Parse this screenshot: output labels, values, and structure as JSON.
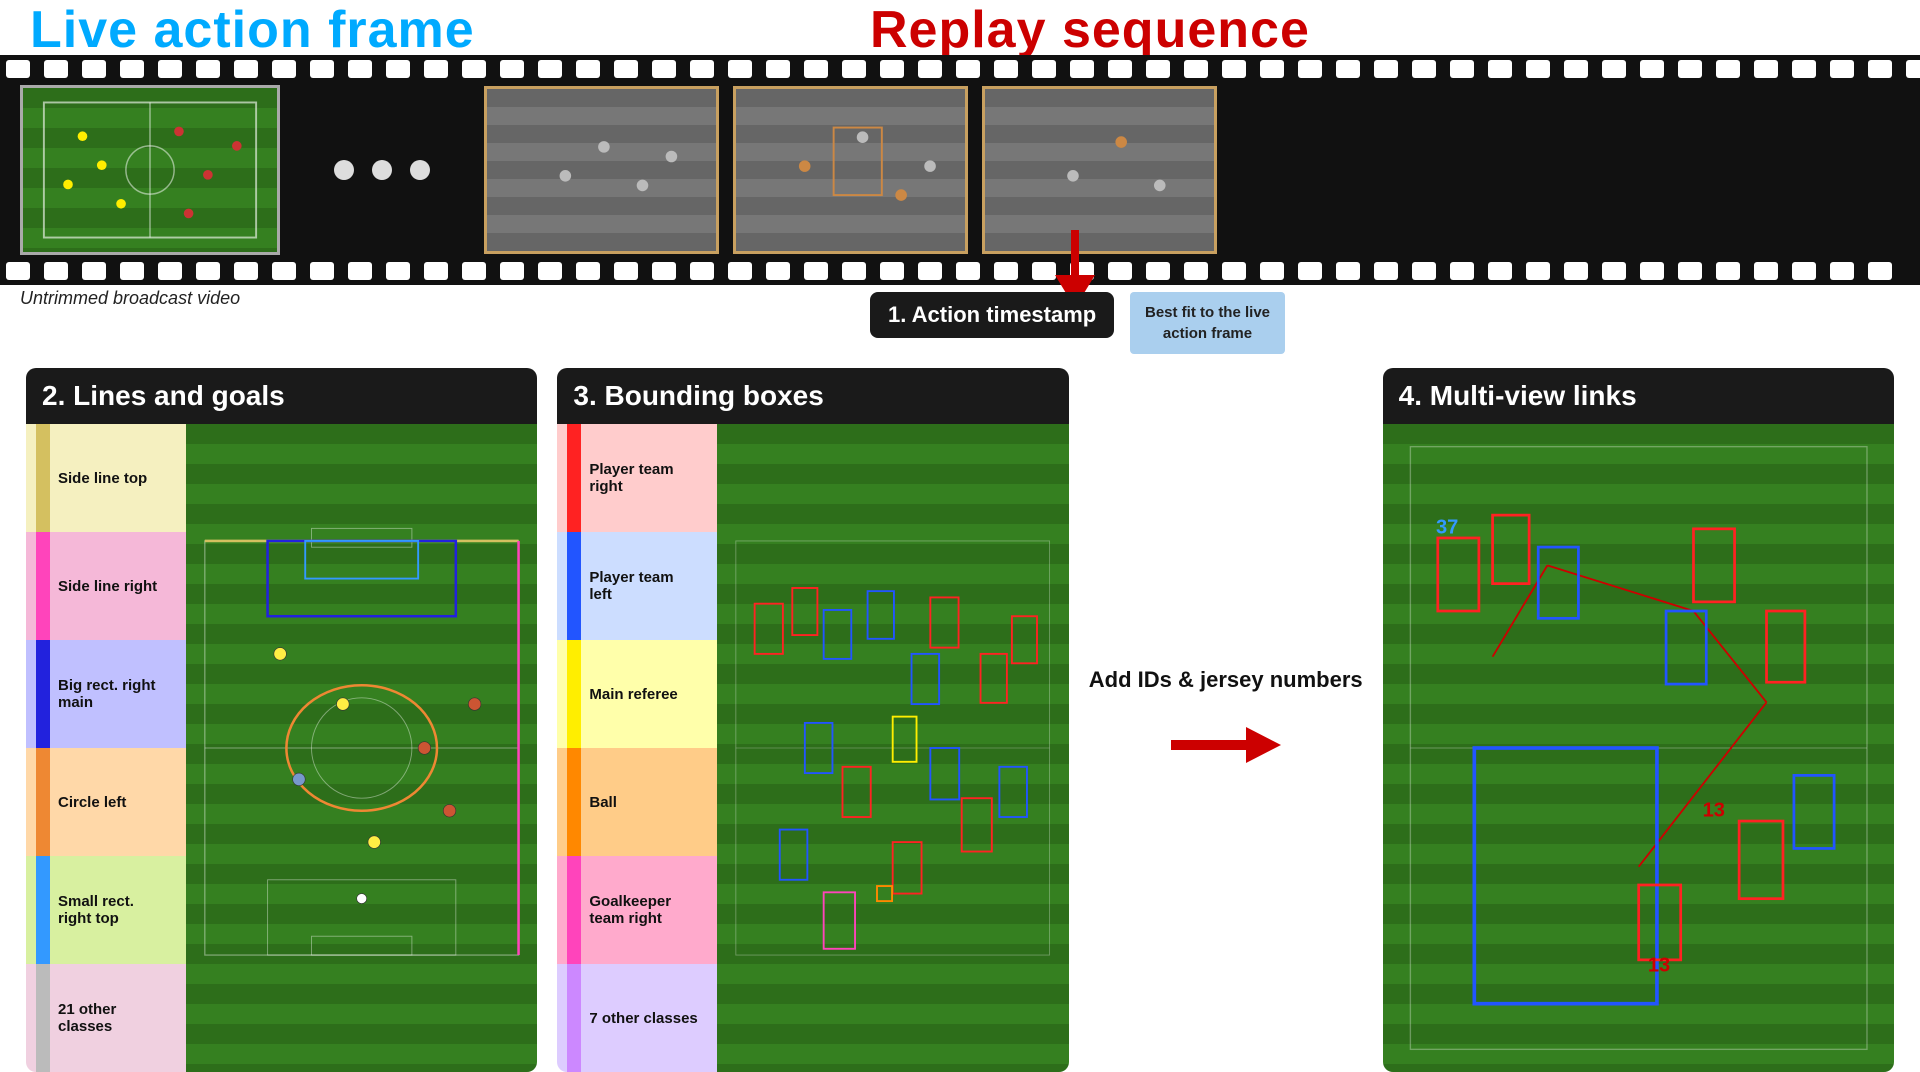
{
  "header": {
    "live_title": "Live action frame",
    "replay_title": "Replay sequence",
    "untrimmed_label": "Untrimmed broadcast video",
    "action_timestamp": "1. Action timestamp",
    "best_fit": "Best fit to the live action frame"
  },
  "panels": {
    "lines_goals": {
      "title": "2. Lines and goals",
      "legend": [
        {
          "label": "Side line top",
          "color": "#d4c060"
        },
        {
          "label": "Side line right",
          "color": "#ff44bb"
        },
        {
          "label": "Big rect. right main",
          "color": "#2222dd"
        },
        {
          "label": "Circle left",
          "color": "#ee8833"
        },
        {
          "label": "Small rect. right top",
          "color": "#3399ff"
        },
        {
          "label": "21 other classes",
          "color": "#cccccc"
        }
      ]
    },
    "bounding_boxes": {
      "title": "3. Bounding boxes",
      "legend": [
        {
          "label": "Player team right",
          "color": "#ff2222"
        },
        {
          "label": "Player team left",
          "color": "#2255ff"
        },
        {
          "label": "Main referee",
          "color": "#ffee00"
        },
        {
          "label": "Ball",
          "color": "#ff8800"
        },
        {
          "label": "Goalkeeper team right",
          "color": "#ff44bb"
        },
        {
          "label": "7 other classes",
          "color": "#cc88ff"
        }
      ]
    },
    "multiview": {
      "title": "4. Multi-view links",
      "add_ids_label": "Add IDs & jersey numbers",
      "number_37": "37",
      "number_13a": "13",
      "number_13b": "13"
    }
  }
}
